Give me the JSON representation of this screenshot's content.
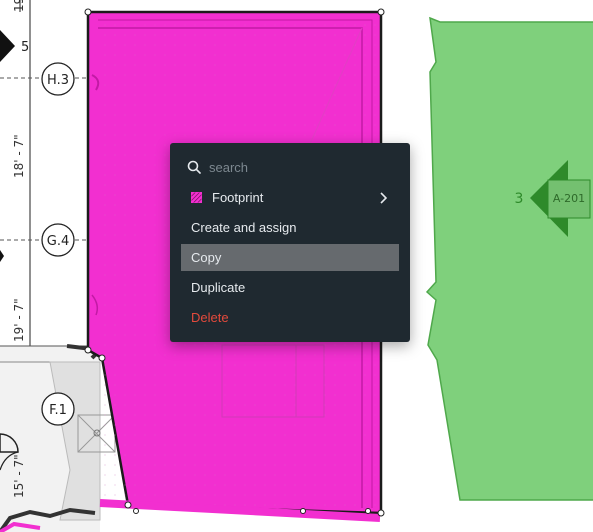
{
  "drawing": {
    "grid_lines": [
      {
        "label": "H.3"
      },
      {
        "label": "G.4"
      },
      {
        "label": "F.1"
      }
    ],
    "dimensions": [
      "19",
      "18' - 7\"",
      "19' - 7\"",
      "15' - 7\""
    ],
    "top_marker_label": "5",
    "callout": {
      "number": "3",
      "sheet": "A-201"
    },
    "colors": {
      "footprint_fill": "#f22fd0",
      "footprint_stroke": "#b30c95",
      "adjacent_fill": "#7fd07c",
      "adjacent_stroke": "#4fa84b",
      "callout": "#2e8a2a"
    }
  },
  "context_menu": {
    "search_placeholder": "search",
    "search_icon": "search-icon",
    "items": [
      {
        "label": "Footprint",
        "icon": "hatch-swatch-icon",
        "has_submenu": true
      },
      {
        "label": "Create and assign"
      },
      {
        "label": "Copy",
        "active": true
      },
      {
        "label": "Duplicate"
      },
      {
        "label": "Delete",
        "danger": true
      }
    ]
  }
}
